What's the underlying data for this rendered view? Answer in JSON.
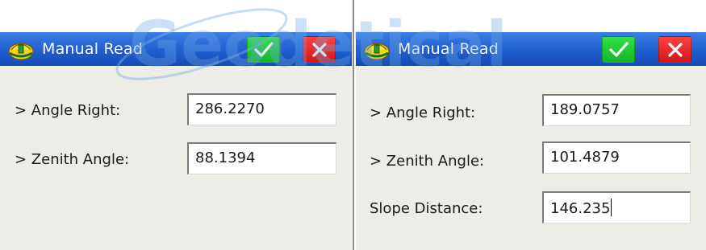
{
  "dialogs": [
    {
      "title": "Manual Read",
      "ok_icon": "checkmark-icon",
      "cancel_icon": "close-icon",
      "fields": [
        {
          "label": "> Angle Right:",
          "value": "286.2270"
        },
        {
          "label": "> Zenith Angle:",
          "value": "88.1394"
        }
      ]
    },
    {
      "title": "Manual Read",
      "ok_icon": "checkmark-icon",
      "cancel_icon": "close-icon",
      "fields": [
        {
          "label": "> Angle Right:",
          "value": "189.0757"
        },
        {
          "label": "> Zenith Angle:",
          "value": "101.4879"
        },
        {
          "label": "Slope Distance:",
          "value": "146.235"
        }
      ]
    }
  ],
  "watermark": "Geodetical",
  "colors": {
    "titlebar": "#1f5fd0",
    "panel": "#edece7",
    "ok": "#16b52a",
    "cancel": "#d01818"
  }
}
